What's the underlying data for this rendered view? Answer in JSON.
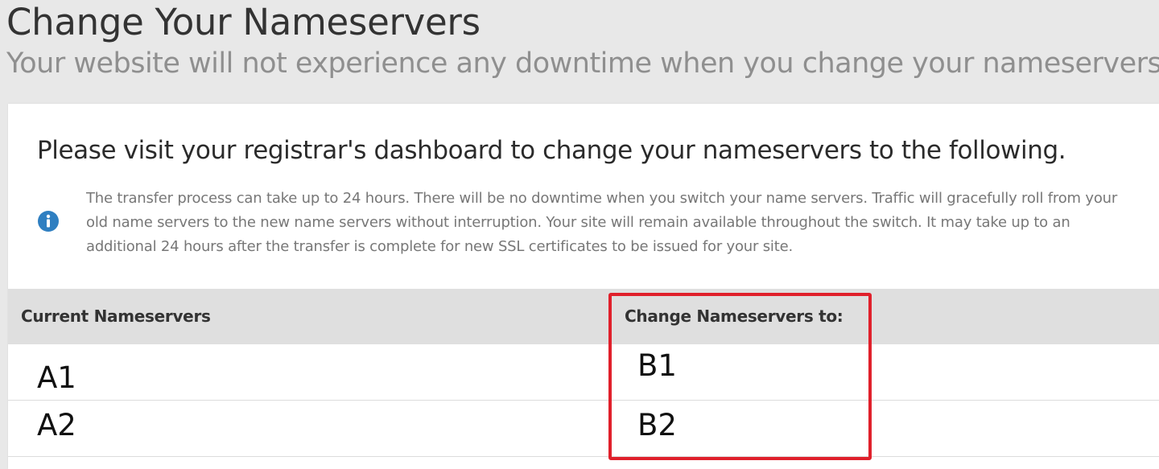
{
  "header": {
    "title": "Change Your Nameservers",
    "subtitle": "Your website will not experience any downtime when you change your nameservers."
  },
  "card": {
    "heading": "Please visit your registrar's dashboard to change your nameservers to the following.",
    "info_icon": "info-circle-icon",
    "info_text": "The transfer process can take up to 24 hours. There will be no downtime when you switch your name servers. Traffic will gracefully roll from your old name servers to the new name servers without interruption. Your site will remain available throughout the switch. It may take up to an additional 24 hours after the transfer is complete for new SSL certificates to be issued for your site."
  },
  "table": {
    "columns": [
      "Current Nameservers",
      "Change Nameservers to:"
    ],
    "rows": [
      {
        "current": "A1",
        "change": "B1"
      },
      {
        "current": "A2",
        "change": "B2"
      }
    ]
  },
  "colors": {
    "info_icon": "#2f7fc1",
    "highlight_border": "#e0202b",
    "page_background": "#e8e8e8",
    "header_row_background": "#dfdfdf"
  }
}
